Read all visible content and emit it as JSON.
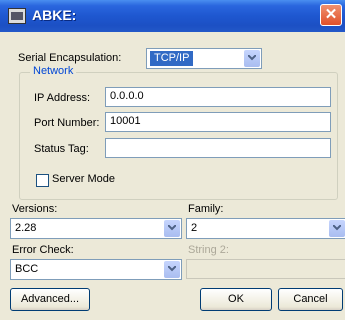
{
  "window": {
    "title": "ABKE:",
    "close_symbol": "✕"
  },
  "serial": {
    "label": "Serial Encapsulation:",
    "value": "TCP/IP"
  },
  "network": {
    "title": "Network",
    "ip_label": "IP Address:",
    "ip_value": "0.0.0.0",
    "port_label": "Port Number:",
    "port_value": "10001",
    "status_label": "Status Tag:",
    "status_value": "",
    "server_mode_label": "Server Mode",
    "server_mode_checked": false
  },
  "versions": {
    "label": "Versions:",
    "value": "2.28"
  },
  "family": {
    "label": "Family:",
    "value": "2"
  },
  "error_check": {
    "label": "Error Check:",
    "value": "BCC"
  },
  "string2": {
    "label": "String 2:",
    "value": ""
  },
  "buttons": {
    "advanced": "Advanced...",
    "ok": "OK",
    "cancel": "Cancel"
  },
  "colors": {
    "titlebar": "#1e57d0",
    "dialog_bg": "#ece9d8",
    "group_title": "#0046d5",
    "selection": "#316ac5"
  }
}
